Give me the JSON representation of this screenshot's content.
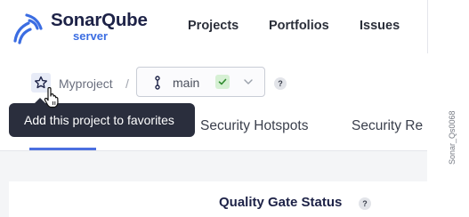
{
  "brand": {
    "name_part1": "Sonar",
    "name_part2": "Qube",
    "subtitle": "server"
  },
  "nav": {
    "items": [
      {
        "label": "Projects"
      },
      {
        "label": "Portfolios"
      },
      {
        "label": "Issues"
      }
    ]
  },
  "breadcrumb": {
    "project": "Myproject",
    "separator": "/",
    "branch": "main"
  },
  "help": {
    "symbol": "?"
  },
  "tooltip": {
    "text": "Add this project to favorites"
  },
  "tabs": [
    {
      "label": "Security Hotspots"
    },
    {
      "label": "Security Re"
    }
  ],
  "content": {
    "quality_gate_title": "Quality Gate Status"
  },
  "watermark": "Sonar_Qs0068",
  "colors": {
    "accent": "#4b6fe0",
    "brand_dark": "#1d2247",
    "brand_blue": "#3b6de2",
    "tooltip_bg": "#2a2e3d",
    "badge_green": "#d6f0d4"
  },
  "icons": {
    "logo": "sonar-waves-logo",
    "favorite": "star-icon",
    "branch": "branch-icon",
    "status": "check-icon",
    "dropdown": "chevron-down-icon",
    "cursor": "hand-pointer-icon"
  }
}
